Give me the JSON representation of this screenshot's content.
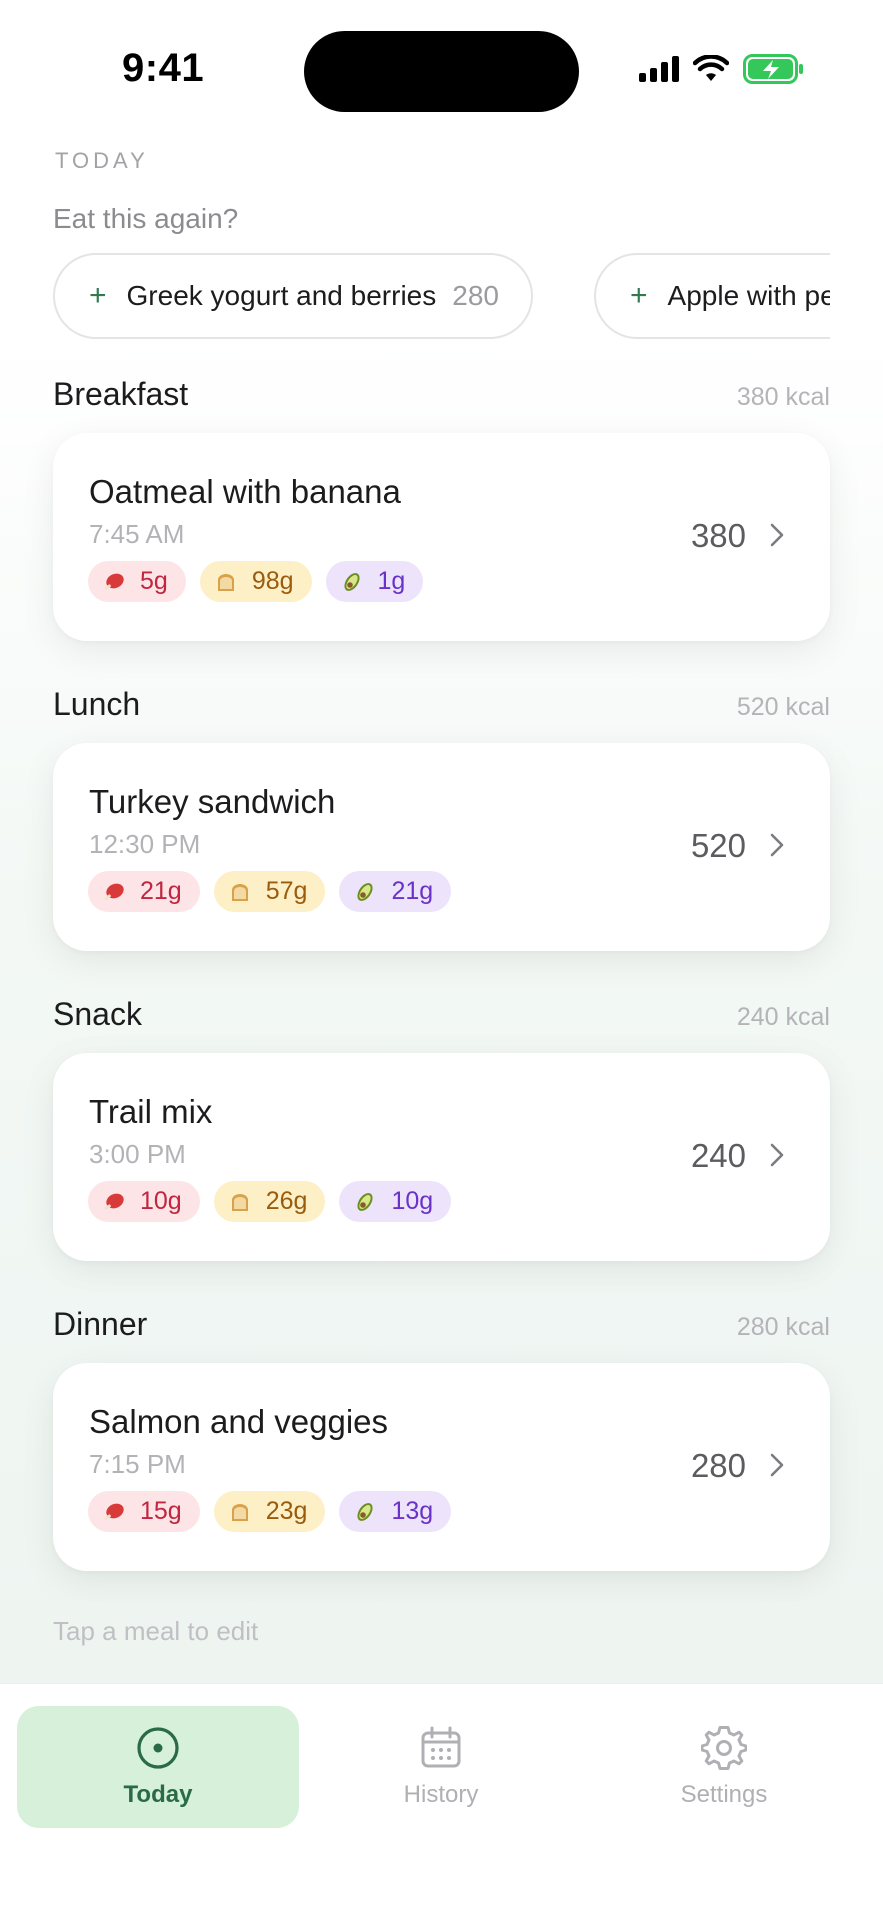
{
  "status_bar": {
    "time": "9:41"
  },
  "header": {
    "section_label": "TODAY",
    "prompt": "Eat this again?"
  },
  "quick_add": [
    {
      "name": "Greek yogurt and berries",
      "kcal": "280"
    },
    {
      "name": "Apple with peanut butter",
      "kcal": ""
    }
  ],
  "meals": [
    {
      "title": "Breakfast",
      "total": "380 kcal",
      "item": "Oatmeal with banana",
      "time": "7:45 AM",
      "kcal": "380",
      "protein": "5g",
      "carbs": "98g",
      "fat": "1g"
    },
    {
      "title": "Lunch",
      "total": "520 kcal",
      "item": "Turkey sandwich",
      "time": "12:30 PM",
      "kcal": "520",
      "protein": "21g",
      "carbs": "57g",
      "fat": "21g"
    },
    {
      "title": "Snack",
      "total": "240 kcal",
      "item": "Trail mix",
      "time": "3:00 PM",
      "kcal": "240",
      "protein": "10g",
      "carbs": "26g",
      "fat": "10g"
    },
    {
      "title": "Dinner",
      "total": "280 kcal",
      "item": "Salmon and veggies",
      "time": "7:15 PM",
      "kcal": "280",
      "protein": "15g",
      "carbs": "23g",
      "fat": "13g"
    }
  ],
  "hint": "Tap a meal to edit",
  "tabs": [
    {
      "label": "Today",
      "icon": "target-icon",
      "active": true
    },
    {
      "label": "History",
      "icon": "calendar-icon",
      "active": false
    },
    {
      "label": "Settings",
      "icon": "gear-icon",
      "active": false
    }
  ],
  "colors": {
    "accent": "#2a6b45",
    "accent_bg": "#d6f0d9",
    "protein": "#c1253f",
    "carbs": "#9b5b0c",
    "fat": "#6a32c8"
  }
}
